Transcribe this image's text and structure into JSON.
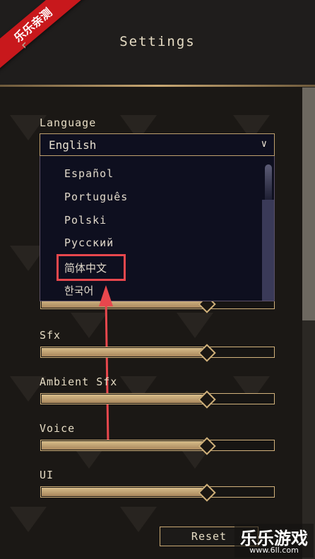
{
  "header": {
    "title": "Settings",
    "badge": "乐乐亲测"
  },
  "language": {
    "label": "Language",
    "selected": "English",
    "options": [
      "Español",
      "Português",
      "Polski",
      "Русский",
      "简体中文",
      "한국어"
    ]
  },
  "sliders": [
    {
      "label": "Sfx",
      "value": 0.71
    },
    {
      "label": "Ambient Sfx",
      "value": 0.71
    },
    {
      "label": "Voice",
      "value": 0.71
    },
    {
      "label": "UI",
      "value": 0.71
    }
  ],
  "hidden_slider_value": 0.71,
  "reset_label": "Reset",
  "watermark": {
    "main": "乐乐游戏",
    "sub": "www.6ll.com"
  },
  "colors": {
    "accent_gold": "#c9a873",
    "annotation_red": "#e8474d",
    "badge_red": "#c8181c"
  },
  "icons": {
    "back": "back-icon",
    "dropdown": "chevron-down-icon"
  }
}
